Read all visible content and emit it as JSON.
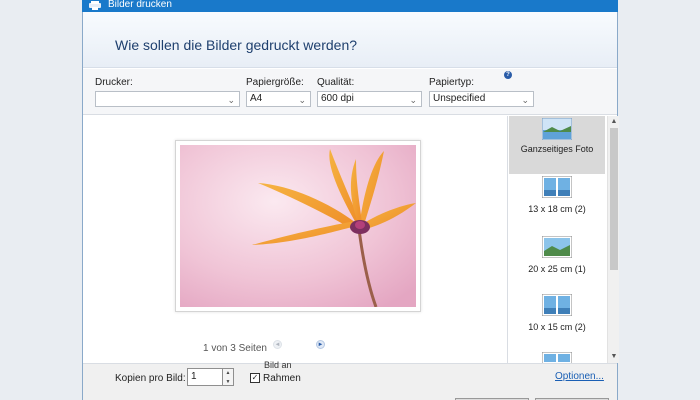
{
  "window": {
    "title": "Bilder drucken",
    "question": "Wie sollen die Bilder gedruckt werden?"
  },
  "options": {
    "printer": {
      "label": "Drucker:",
      "value": ""
    },
    "paper_size": {
      "label": "Papiergröße:",
      "value": "A4"
    },
    "quality": {
      "label": "Qualität:",
      "value": "600 dpi"
    },
    "paper_type": {
      "label": "Papiertyp:",
      "value": "Unspecified"
    },
    "help_icon": "?"
  },
  "preview": {
    "page_info": "1 von 3 Seiten",
    "prev_icon": "◄",
    "next_icon": "►"
  },
  "layouts": {
    "items": [
      {
        "label": "Ganzseitiges Foto",
        "selected": true
      },
      {
        "label": "13 x 18 cm (2)",
        "selected": false
      },
      {
        "label": "20 x 25 cm (1)",
        "selected": false
      },
      {
        "label": "10 x 15 cm (2)",
        "selected": false
      }
    ],
    "scroll_up": "▲",
    "scroll_down": "▼"
  },
  "footer": {
    "copies_label": "Kopien pro Bild:",
    "copies_value": "1",
    "fit_label_top": "Bild an",
    "fit_label": "Rahmen",
    "fit_checked": "✓",
    "options_link": "Optionen..."
  },
  "colors": {
    "titlebar": "#1979ca",
    "accent": "#1a5fb4",
    "selected_layout": "#d9d9d9"
  }
}
